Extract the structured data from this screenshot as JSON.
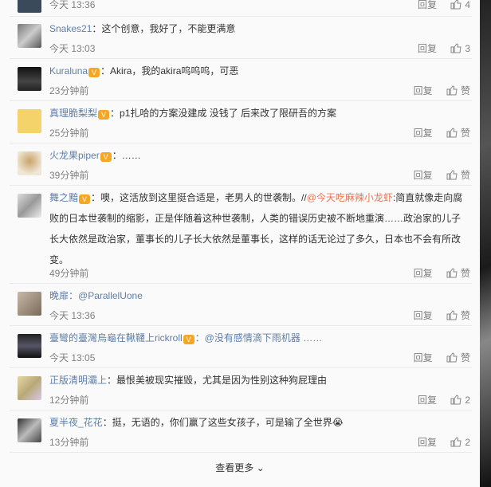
{
  "comments": [
    {
      "user": "",
      "text": "",
      "time": "今天 13:36",
      "reply": "回复",
      "likes": "4",
      "badge": false
    },
    {
      "user": "Snakes21",
      "text": "：这个创意，我好了，不能更满意",
      "time": "今天 13:03",
      "reply": "回复",
      "likes": "3",
      "badge": false
    },
    {
      "user": "Kuraluna",
      "text": "：Akira，我的akira呜呜呜，可恶",
      "time": "23分钟前",
      "reply": "回复",
      "likes": "赞",
      "badge": true
    },
    {
      "user": "真理脆梨梨",
      "text": "：p1扎哈的方案没建成 没钱了 后来改了限研吾的方案",
      "time": "25分钟前",
      "reply": "回复",
      "likes": "赞",
      "badge": true
    },
    {
      "user": "火龙果piper",
      "text": "：……",
      "time": "39分钟前",
      "reply": "回复",
      "likes": "赞",
      "badge": true
    },
    {
      "user": "舞之黯",
      "text": "：噢，这活放到这里挺合适是，老男人的世袭制。//",
      "mention": "@今天吃麻辣小龙虾",
      "text2": ":简直就像走向腐败的日本世袭制的缩影，正是伴随着这种世袭制，人类的错误历史被不断地重演……政治家的儿子长大依然是政治家，董事长的儿子长大依然是董事长，这样的话无论过了多久，日本也不会有所改变。",
      "time": "49分钟前",
      "reply": "回复",
      "likes": "赞",
      "badge": true
    },
    {
      "user": "晚扉",
      "text": "：@ParallelUone",
      "time": "今天 13:36",
      "reply": "回复",
      "likes": "赞",
      "badge": false
    },
    {
      "user": "臺彎的臺灣烏龜在鞦韆上rickroll",
      "text": "：@没有感情滴下雨机器 ……",
      "time": "今天 13:05",
      "reply": "回复",
      "likes": "赞",
      "badge": true
    },
    {
      "user": "正版清明灞上",
      "text": "：最恨美被现实摧毁，尤其是因为性别这种狗屁理由",
      "time": "12分钟前",
      "reply": "回复",
      "likes": "2",
      "badge": false
    },
    {
      "user": "夏半夜_花花",
      "text": "：挺，无语的，你们赢了这些女孩子，可是输了全世界😭",
      "time": "13分钟前",
      "reply": "回复",
      "likes": "2",
      "badge": false
    }
  ],
  "more_label": "查看更多",
  "colors": {
    "name": "#eb7350",
    "link": "#5e7ea8",
    "meta": "#808080"
  }
}
